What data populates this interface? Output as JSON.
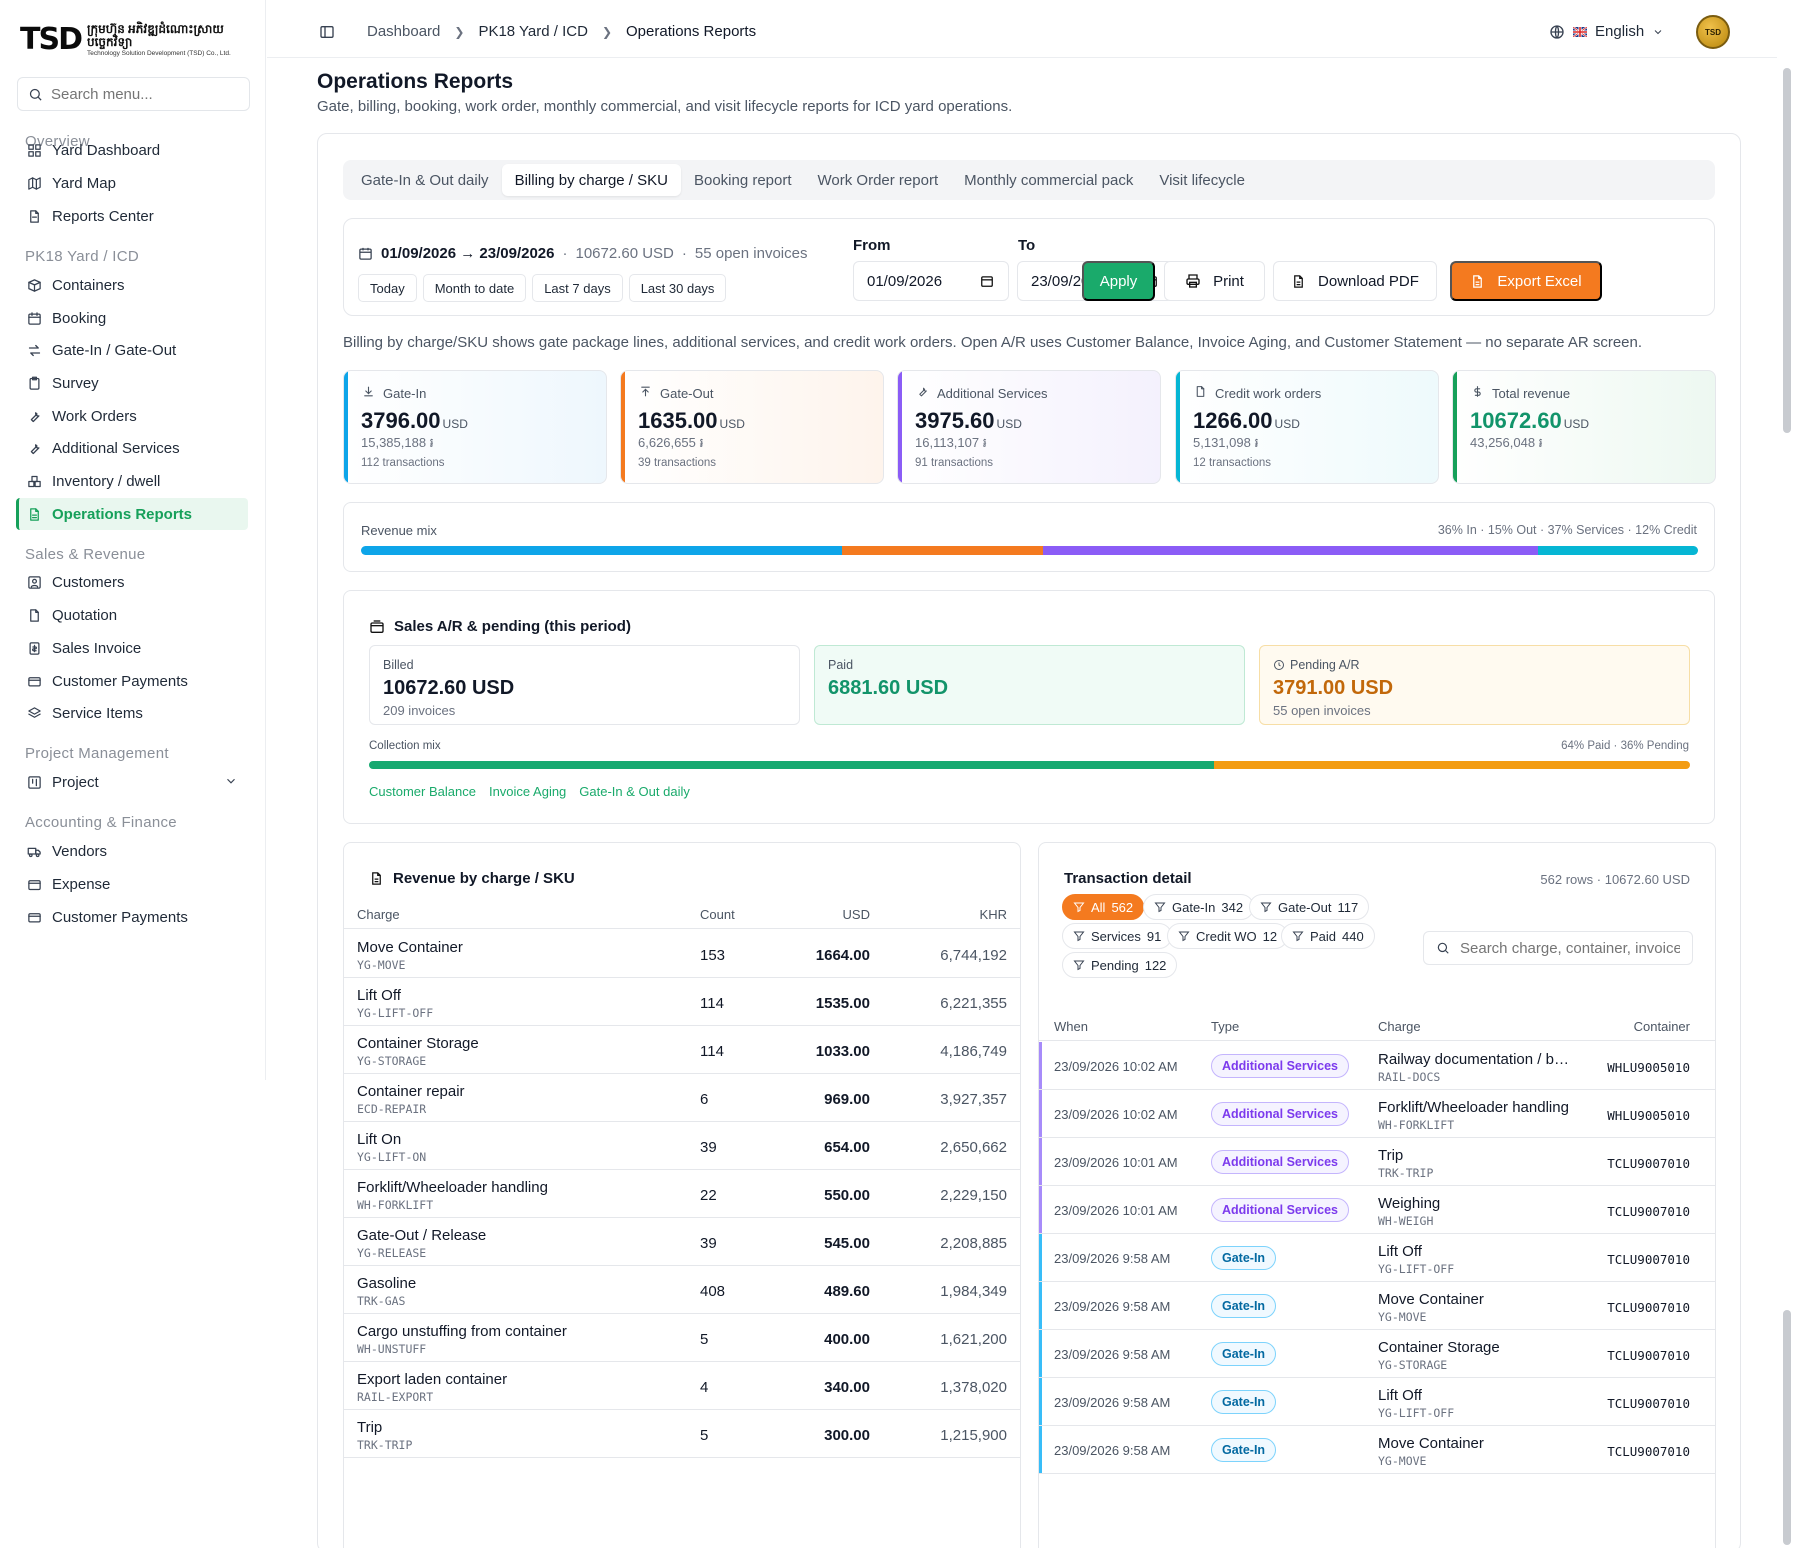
{
  "brand": {
    "mark": "TSD",
    "line1": "ក្រុមហ៊ុន អភិវឌ្ឍដំណោះស្រាយបច្ចេកវិទ្យា",
    "line2": "Technology Solution Development (TSD) Co., Ltd."
  },
  "sidebar": {
    "search_placeholder": "Search menu...",
    "sections": {
      "overview": "Overview",
      "yard": "PK18 Yard / ICD",
      "sales": "Sales & Revenue",
      "project": "Project Management",
      "accounting": "Accounting & Finance"
    },
    "items": [
      {
        "label": "Yard Dashboard",
        "icon": "grid-icon"
      },
      {
        "label": "Yard Map",
        "icon": "map-icon"
      },
      {
        "label": "Reports Center",
        "icon": "report-icon"
      },
      {
        "label": "Containers",
        "icon": "box-icon"
      },
      {
        "label": "Booking",
        "icon": "calendar-icon"
      },
      {
        "label": "Gate-In / Gate-Out",
        "icon": "swap-icon"
      },
      {
        "label": "Survey",
        "icon": "clipboard-icon"
      },
      {
        "label": "Work Orders",
        "icon": "wrench-icon"
      },
      {
        "label": "Additional Services",
        "icon": "wrench-icon"
      },
      {
        "label": "Inventory / dwell",
        "icon": "boxes-icon"
      },
      {
        "label": "Operations Reports",
        "icon": "spreadsheet-icon"
      },
      {
        "label": "Customers",
        "icon": "user-square-icon"
      },
      {
        "label": "Quotation",
        "icon": "file-icon"
      },
      {
        "label": "Sales Invoice",
        "icon": "invoice-icon"
      },
      {
        "label": "Customer Payments",
        "icon": "card-icon"
      },
      {
        "label": "Service Items",
        "icon": "layers-icon"
      },
      {
        "label": "Project",
        "icon": "kanban-icon"
      },
      {
        "label": "Vendors",
        "icon": "truck-icon"
      },
      {
        "label": "Expense",
        "icon": "wallet-icon"
      },
      {
        "label": "Customer Payments",
        "icon": "card-icon"
      }
    ]
  },
  "topbar": {
    "breadcrumb": [
      "Dashboard",
      "PK18 Yard / ICD",
      "Operations Reports"
    ],
    "language": "English",
    "avatar_text": "TSD"
  },
  "page": {
    "title": "Operations Reports",
    "subtitle": "Gate, billing, booking, work order, monthly commercial, and visit lifecycle reports for ICD yard operations."
  },
  "tabs": [
    "Gate-In & Out daily",
    "Billing by charge / SKU",
    "Booking report",
    "Work Order report",
    "Monthly commercial pack",
    "Visit lifecycle"
  ],
  "filter": {
    "range": "01/09/2026 → 23/09/2026",
    "total": "10672.60 USD",
    "open_invoices": "55 open invoices",
    "quick": [
      "Today",
      "Month to date",
      "Last 7 days",
      "Last 30 days"
    ],
    "from_label": "From",
    "to_label": "To",
    "from_value": "01/09/2026",
    "to_value": "23/09/2026",
    "apply": "Apply",
    "print": "Print",
    "download_pdf": "Download PDF",
    "export_excel": "Export Excel"
  },
  "note": "Billing by charge/SKU shows gate package lines, additional services, and credit work orders. Open A/R uses Customer Balance, Invoice Aging, and Customer Statement — no separate AR screen.",
  "kpis": [
    {
      "label": "Gate-In",
      "value": "3796.00",
      "unit": "USD",
      "khr": "15,385,188 ៛",
      "tx": "112 transactions",
      "color": "#0ea5e9",
      "tint": "#eef7fd",
      "icon": "download-icon"
    },
    {
      "label": "Gate-Out",
      "value": "1635.00",
      "unit": "USD",
      "khr": "6,626,655 ៛",
      "tx": "39 transactions",
      "color": "#f47a1f",
      "tint": "#fef4ec",
      "icon": "upload-icon"
    },
    {
      "label": "Additional Services",
      "value": "3975.60",
      "unit": "USD",
      "khr": "16,113,107 ៛",
      "tx": "91 transactions",
      "color": "#8b5cf6",
      "tint": "#f4f1fd",
      "icon": "wrench-icon"
    },
    {
      "label": "Credit work orders",
      "value": "1266.00",
      "unit": "USD",
      "khr": "5,131,098 ៛",
      "tx": "12 transactions",
      "color": "#06b6d4",
      "tint": "#eefafc",
      "icon": "file-icon"
    },
    {
      "label": "Total revenue",
      "value": "10672.60",
      "unit": "USD",
      "khr": "43,256,048 ៛",
      "tx": "",
      "color": "#16a05a",
      "tint": "#edf8f1",
      "icon": "dollar-icon"
    }
  ],
  "revenue_mix": {
    "label": "Revenue mix",
    "summary": "36% In · 15% Out · 37% Services · 12% Credit",
    "segments": [
      {
        "pct": 36,
        "color": "#0ea5e9"
      },
      {
        "pct": 15,
        "color": "#f47a1f"
      },
      {
        "pct": 37,
        "color": "#8b5cf6"
      },
      {
        "pct": 12,
        "color": "#06b6d4"
      }
    ]
  },
  "ar": {
    "title": "Sales A/R & pending (this period)",
    "billed_label": "Billed",
    "billed_value": "10672.60 USD",
    "billed_sub": "209 invoices",
    "paid_label": "Paid",
    "paid_value": "6881.60 USD",
    "pending_label": "Pending A/R",
    "pending_value": "3791.00 USD",
    "pending_sub": "55 open invoices",
    "collection_label": "Collection mix",
    "collection_summary": "64% Paid · 36% Pending",
    "paid_pct": 64,
    "pending_pct": 36,
    "links": [
      "Customer Balance",
      "Invoice Aging",
      "Gate-In & Out daily"
    ]
  },
  "revenue_table": {
    "title": "Revenue by charge / SKU",
    "columns": [
      "Charge",
      "Count",
      "USD",
      "KHR"
    ],
    "rows": [
      {
        "name": "Move Container",
        "sku": "YG-MOVE",
        "count": "153",
        "usd": "1664.00",
        "khr": "6,744,192"
      },
      {
        "name": "Lift Off",
        "sku": "YG-LIFT-OFF",
        "count": "114",
        "usd": "1535.00",
        "khr": "6,221,355"
      },
      {
        "name": "Container Storage",
        "sku": "YG-STORAGE",
        "count": "114",
        "usd": "1033.00",
        "khr": "4,186,749"
      },
      {
        "name": "Container repair",
        "sku": "ECD-REPAIR",
        "count": "6",
        "usd": "969.00",
        "khr": "3,927,357"
      },
      {
        "name": "Lift On",
        "sku": "YG-LIFT-ON",
        "count": "39",
        "usd": "654.00",
        "khr": "2,650,662"
      },
      {
        "name": "Forklift/Wheeloader handling",
        "sku": "WH-FORKLIFT",
        "count": "22",
        "usd": "550.00",
        "khr": "2,229,150"
      },
      {
        "name": "Gate-Out / Release",
        "sku": "YG-RELEASE",
        "count": "39",
        "usd": "545.00",
        "khr": "2,208,885"
      },
      {
        "name": "Gasoline",
        "sku": "TRK-GAS",
        "count": "408",
        "usd": "489.60",
        "khr": "1,984,349"
      },
      {
        "name": "Cargo unstuffing from container",
        "sku": "WH-UNSTUFF",
        "count": "5",
        "usd": "400.00",
        "khr": "1,621,200"
      },
      {
        "name": "Export laden container",
        "sku": "RAIL-EXPORT",
        "count": "4",
        "usd": "340.00",
        "khr": "1,378,020"
      },
      {
        "name": "Trip",
        "sku": "TRK-TRIP",
        "count": "5",
        "usd": "300.00",
        "khr": "1,215,900"
      }
    ]
  },
  "transactions": {
    "title": "Transaction detail",
    "meta": "562 rows · 10672.60 USD",
    "chips": [
      {
        "label": "All",
        "count": "562"
      },
      {
        "label": "Gate-In",
        "count": "342"
      },
      {
        "label": "Gate-Out",
        "count": "117"
      },
      {
        "label": "Services",
        "count": "91"
      },
      {
        "label": "Credit WO",
        "count": "12"
      },
      {
        "label": "Paid",
        "count": "440"
      },
      {
        "label": "Pending",
        "count": "122"
      }
    ],
    "search_placeholder": "Search charge, container, invoice",
    "columns": [
      "When",
      "Type",
      "Charge",
      "Container"
    ],
    "rows": [
      {
        "when": "23/09/2026 10:02 AM",
        "type": "Additional Services",
        "charge": "Railway documentation / booking",
        "sku": "RAIL-DOCS",
        "container": "WHLU9005010"
      },
      {
        "when": "23/09/2026 10:02 AM",
        "type": "Additional Services",
        "charge": "Forklift/Wheeloader handling",
        "sku": "WH-FORKLIFT",
        "container": "WHLU9005010"
      },
      {
        "when": "23/09/2026 10:01 AM",
        "type": "Additional Services",
        "charge": "Trip",
        "sku": "TRK-TRIP",
        "container": "TCLU9007010"
      },
      {
        "when": "23/09/2026 10:01 AM",
        "type": "Additional Services",
        "charge": "Weighing",
        "sku": "WH-WEIGH",
        "container": "TCLU9007010"
      },
      {
        "when": "23/09/2026 9:58 AM",
        "type": "Gate-In",
        "charge": "Lift Off",
        "sku": "YG-LIFT-OFF",
        "container": "TCLU9007010"
      },
      {
        "when": "23/09/2026 9:58 AM",
        "type": "Gate-In",
        "charge": "Move Container",
        "sku": "YG-MOVE",
        "container": "TCLU9007010"
      },
      {
        "when": "23/09/2026 9:58 AM",
        "type": "Gate-In",
        "charge": "Container Storage",
        "sku": "YG-STORAGE",
        "container": "TCLU9007010"
      },
      {
        "when": "23/09/2026 9:58 AM",
        "type": "Gate-In",
        "charge": "Lift Off",
        "sku": "YG-LIFT-OFF",
        "container": "TCLU9007010"
      },
      {
        "when": "23/09/2026 9:58 AM",
        "type": "Gate-In",
        "charge": "Move Container",
        "sku": "YG-MOVE",
        "container": "TCLU9007010"
      }
    ]
  },
  "colors": {
    "accent": "#16a05a",
    "orange": "#f47a1f",
    "gate_in": "#0ea5e9",
    "services": "#8b5cf6",
    "credit": "#06b6d4",
    "pending": "#f59e0b"
  }
}
